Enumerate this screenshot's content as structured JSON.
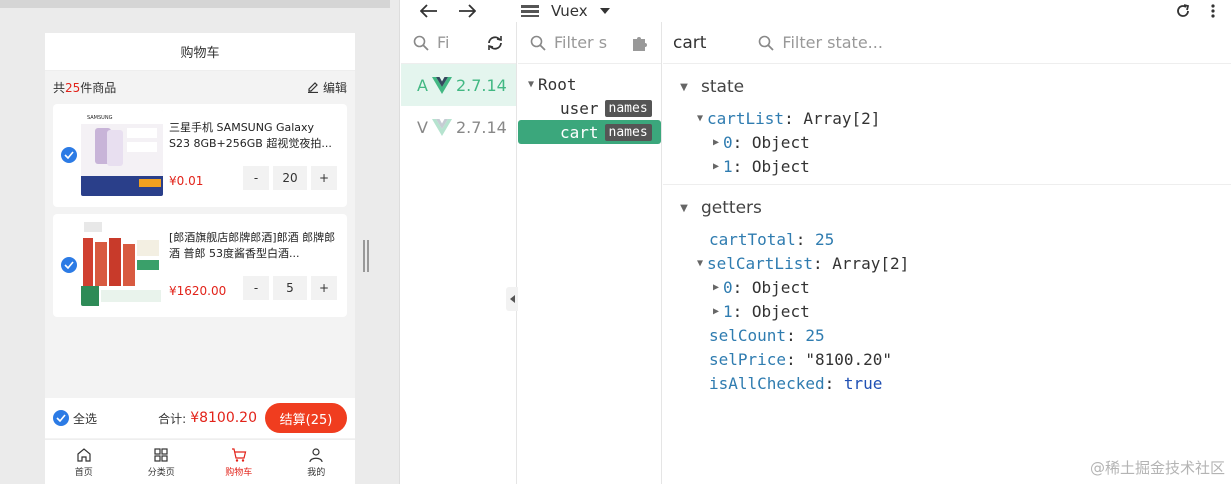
{
  "phone": {
    "nav_title": "购物车",
    "summary_prefix": "共",
    "summary_count": "25",
    "summary_suffix": "件商品",
    "edit_label": "编辑",
    "items": [
      {
        "title": "三星手机 SAMSUNG Galaxy S23 8GB+256GB 超视觉夜拍...",
        "price": "¥0.01",
        "qty": "20",
        "checked": true
      },
      {
        "title": "[郎酒旗舰店郎牌郎酒]郎酒 郎牌郎酒 普郎 53度酱香型白酒...",
        "price": "¥1620.00",
        "qty": "5",
        "checked": true
      }
    ],
    "minus_label": "-",
    "plus_label": "+",
    "select_all_label": "全选",
    "total_label": "合计:",
    "total_amount": "¥8100.20",
    "checkout_label": "结算(25)",
    "tabs": [
      {
        "label": "首页",
        "icon": "home-icon"
      },
      {
        "label": "分类页",
        "icon": "category-icon"
      },
      {
        "label": "购物车",
        "icon": "cart-icon"
      },
      {
        "label": "我的",
        "icon": "user-icon"
      }
    ]
  },
  "devtools": {
    "plugin_name": "Vuex",
    "apps_search_placeholder": "Fi",
    "apps": [
      {
        "prefix": "A",
        "version": "2.7.14"
      },
      {
        "prefix": "V",
        "version": "2.7.14"
      }
    ],
    "modules_search_placeholder": "Filter s",
    "tree": {
      "root": "Root",
      "modules": [
        {
          "name": "user",
          "badge": "names"
        },
        {
          "name": "cart",
          "badge": "names"
        }
      ]
    },
    "selected_module": "cart",
    "state_filter_placeholder": "Filter state...",
    "state_title": "state",
    "getters_title": "getters",
    "state": {
      "cartList_key": "cartList",
      "cartList_val": "Array[2]",
      "cartList_items": [
        {
          "key": "0",
          "val": "Object"
        },
        {
          "key": "1",
          "val": "Object"
        }
      ]
    },
    "getters": {
      "cartTotal_key": "cartTotal",
      "cartTotal_val": "25",
      "selCartList_key": "selCartList",
      "selCartList_val": "Array[2]",
      "selCartList_items": [
        {
          "key": "0",
          "val": "Object"
        },
        {
          "key": "1",
          "val": "Object"
        }
      ],
      "selCount_key": "selCount",
      "selCount_val": "25",
      "selPrice_key": "selPrice",
      "selPrice_val": "\"8100.20\"",
      "isAllChecked_key": "isAllChecked",
      "isAllChecked_val": "true"
    }
  },
  "watermark": "@稀土掘金技术社区",
  "colors": {
    "vue_green": "#42b883",
    "price_red": "#e2231a",
    "checkout_orange": "#f03d1f",
    "check_blue": "#2c7be5",
    "key_blue": "#2f7cb0"
  }
}
